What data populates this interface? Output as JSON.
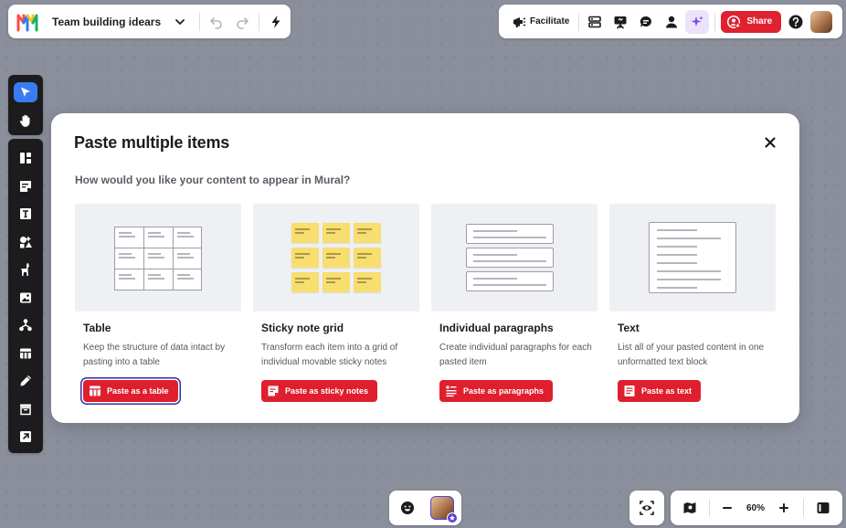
{
  "header": {
    "board_title": "Team building idears",
    "facilitate_label": "Facilitate",
    "share_label": "Share"
  },
  "modal": {
    "title": "Paste multiple items",
    "question": "How would you like your content to appear in Mural?",
    "options": [
      {
        "title": "Table",
        "description": "Keep the structure of data intact by pasting into a table",
        "button": "Paste as a table",
        "icon": "table-icon"
      },
      {
        "title": "Sticky note grid",
        "description": "Transform each item into a grid of individual movable sticky notes",
        "button": "Paste as sticky notes",
        "icon": "sticky-note-icon"
      },
      {
        "title": "Individual paragraphs",
        "description": "Create individual paragraphs for each pasted item",
        "button": "Paste as paragraphs",
        "icon": "paragraphs-icon"
      },
      {
        "title": "Text",
        "description": "List all of your pasted content in one unformatted text block",
        "button": "Paste as text",
        "icon": "text-block-icon"
      }
    ]
  },
  "zoom": {
    "level": "60%"
  },
  "colors": {
    "accent_red": "#e0212f",
    "select_blue": "#3b7bf2",
    "toolbar_dark": "#1c1c1e",
    "sticky_yellow": "#f7de6f"
  }
}
